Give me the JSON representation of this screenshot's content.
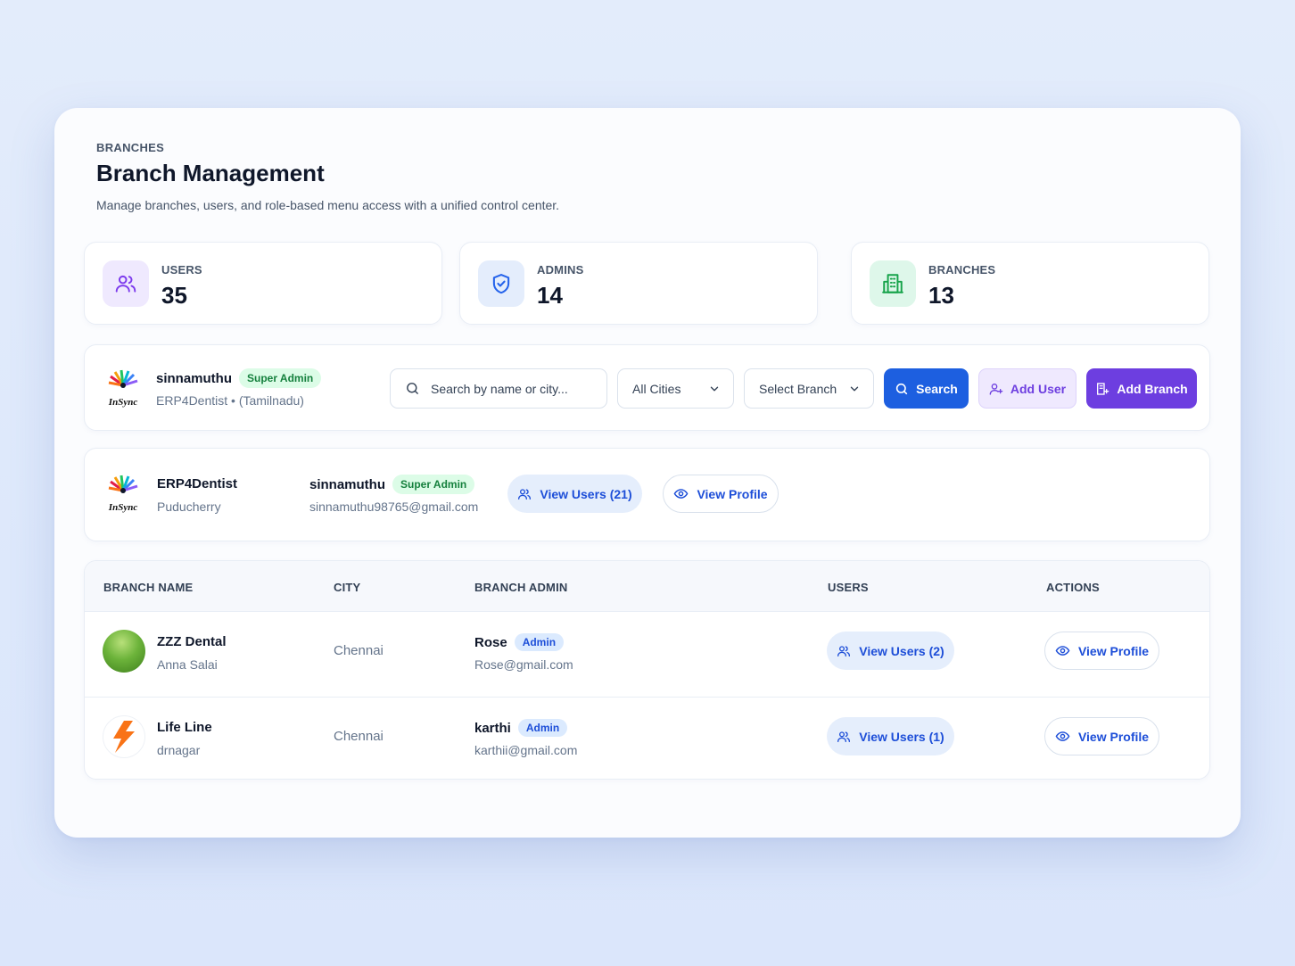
{
  "header": {
    "eyebrow": "BRANCHES",
    "title": "Branch Management",
    "subtitle": "Manage branches, users, and role-based menu access with a unified control center."
  },
  "stats": [
    {
      "label": "USERS",
      "value": "35",
      "icon": "users-icon",
      "tint": "#efe9fe",
      "color": "#7c3aed"
    },
    {
      "label": "ADMINS",
      "value": "14",
      "icon": "shield-check-icon",
      "tint": "#e4edfc",
      "color": "#2563eb"
    },
    {
      "label": "BRANCHES",
      "value": "13",
      "icon": "building-icon",
      "tint": "#def7ea",
      "color": "#16a34a"
    }
  ],
  "current_user": {
    "name": "sinnamuthu",
    "role": "Super Admin",
    "org": "ERP4Dentist • (Tamilnadu)",
    "logo_text": "InSync"
  },
  "filters": {
    "search_placeholder": "Search by name or city...",
    "city": "All Cities",
    "branch": "Select Branch",
    "search_button": "Search",
    "add_user_button": "Add User",
    "add_branch_button": "Add Branch"
  },
  "main_branch": {
    "name": "ERP4Dentist",
    "city": "Puducherry",
    "admin_name": "sinnamuthu",
    "admin_role": "Super Admin",
    "admin_email": "sinnamuthu98765@gmail.com",
    "view_users": "View Users (21)",
    "view_profile": "View Profile"
  },
  "table": {
    "columns": [
      "BRANCH NAME",
      "CITY",
      "BRANCH ADMIN",
      "USERS",
      "ACTIONS"
    ],
    "rows": [
      {
        "name": "ZZZ Dental",
        "area": "Anna Salai",
        "city": "Chennai",
        "admin": "Rose",
        "role": "Admin",
        "email": "Rose@gmail.com",
        "users": "View Users (2)",
        "action": "View Profile"
      },
      {
        "name": "Life Line",
        "area": "drnagar",
        "city": "Chennai",
        "admin": "karthi",
        "role": "Admin",
        "email": "karthii@gmail.com",
        "users": "View Users (1)",
        "action": "View Profile"
      }
    ]
  },
  "colors": {
    "primary": "#1d5fe0",
    "purple": "#6d3ee0",
    "purple_soft": "#efe9fe",
    "success": "#15803d"
  }
}
